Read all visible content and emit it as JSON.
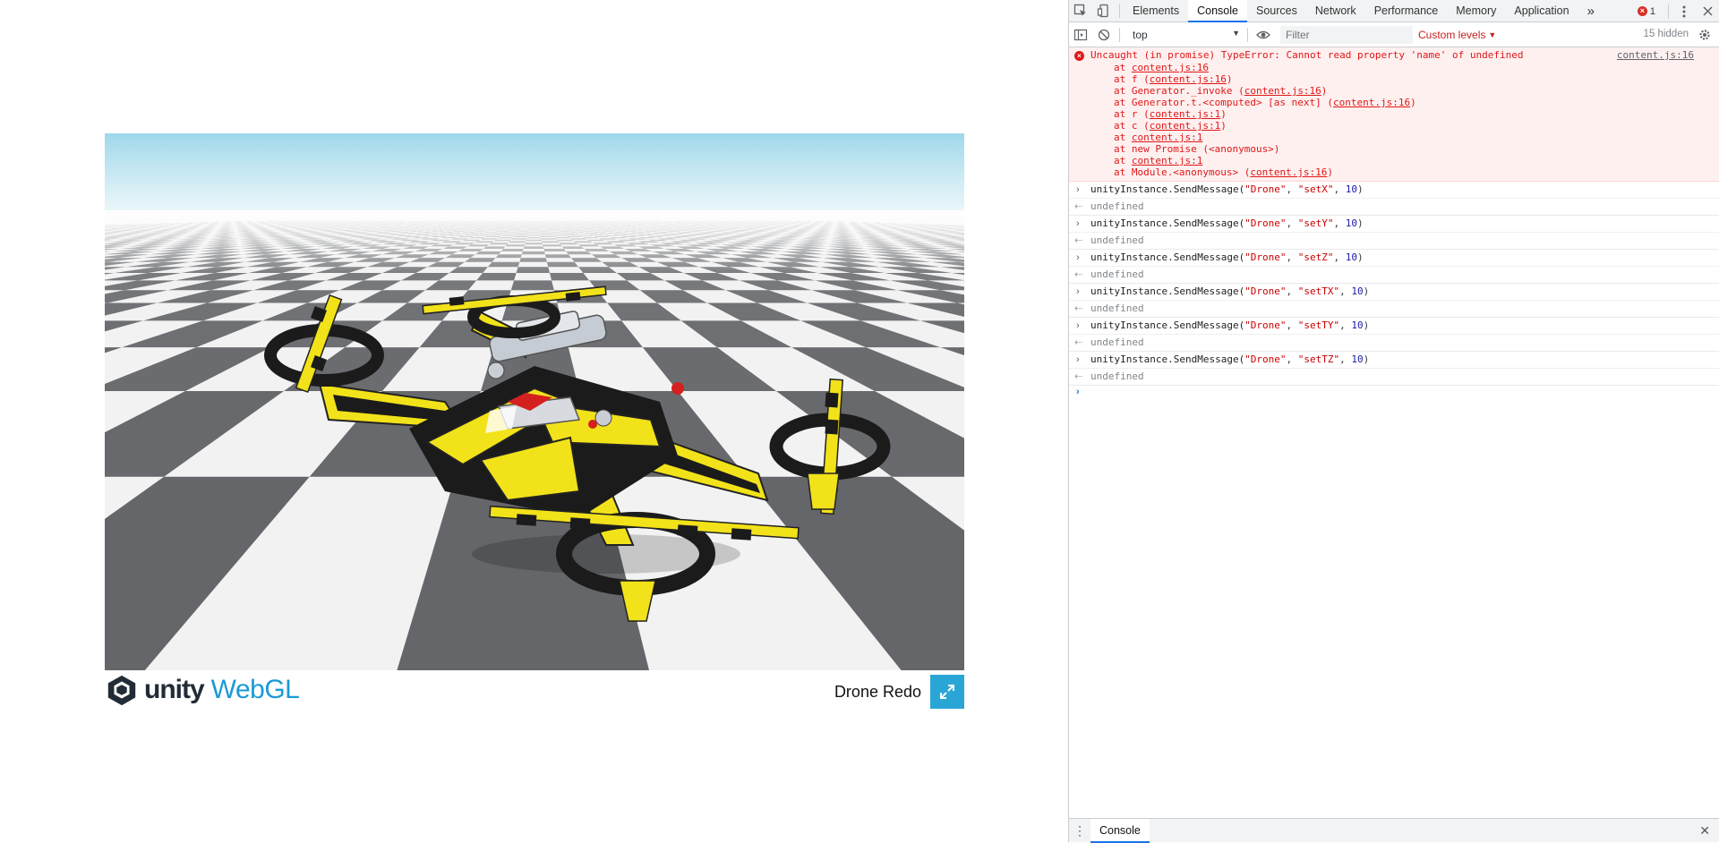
{
  "build": {
    "engine_word": "unity",
    "platform_word": "WebGL",
    "title": "Drone Redo"
  },
  "devtools": {
    "tabs": [
      "Elements",
      "Console",
      "Sources",
      "Network",
      "Performance",
      "Memory",
      "Application"
    ],
    "active_tab": "Console",
    "more_tabs": "»",
    "error_count": "1",
    "context": "top",
    "filter_placeholder": "Filter",
    "levels_label": "Custom levels",
    "hidden_label": "15 hidden",
    "drawer_tab": "Console"
  },
  "console": {
    "error": {
      "message": "Uncaught (in promise) TypeError: Cannot read property 'name' of undefined",
      "source": "content.js:16",
      "stack": [
        {
          "prefix": "at ",
          "link": "content.js:16",
          "suffix": ""
        },
        {
          "prefix": "at f (",
          "link": "content.js:16",
          "suffix": ")"
        },
        {
          "prefix": "at Generator._invoke (",
          "link": "content.js:16",
          "suffix": ")"
        },
        {
          "prefix": "at Generator.t.<computed> [as next] (",
          "link": "content.js:16",
          "suffix": ")"
        },
        {
          "prefix": "at r (",
          "link": "content.js:1",
          "suffix": ")"
        },
        {
          "prefix": "at c (",
          "link": "content.js:1",
          "suffix": ")"
        },
        {
          "prefix": "at ",
          "link": "content.js:1",
          "suffix": ""
        },
        {
          "prefix": "at new Promise (<anonymous>)",
          "link": "",
          "suffix": ""
        },
        {
          "prefix": "at ",
          "link": "content.js:1",
          "suffix": ""
        },
        {
          "prefix": "at Module.<anonymous> (",
          "link": "content.js:16",
          "suffix": ")"
        }
      ]
    },
    "commands": [
      {
        "fn": "unityInstance.SendMessage(",
        "obj": "\"Drone\"",
        "method": "\"setX\"",
        "num": "10",
        "result": "undefined"
      },
      {
        "fn": "unityInstance.SendMessage(",
        "obj": "\"Drone\"",
        "method": "\"setY\"",
        "num": "10",
        "result": "undefined"
      },
      {
        "fn": "unityInstance.SendMessage(",
        "obj": "\"Drone\"",
        "method": "\"setZ\"",
        "num": "10",
        "result": "undefined"
      },
      {
        "fn": "unityInstance.SendMessage(",
        "obj": "\"Drone\"",
        "method": "\"setTX\"",
        "num": "10",
        "result": "undefined"
      },
      {
        "fn": "unityInstance.SendMessage(",
        "obj": "\"Drone\"",
        "method": "\"setTY\"",
        "num": "10",
        "result": "undefined"
      },
      {
        "fn": "unityInstance.SendMessage(",
        "obj": "\"Drone\"",
        "method": "\"setTZ\"",
        "num": "10",
        "result": "undefined"
      }
    ]
  },
  "colors": {
    "accent": "#1a73e8",
    "error": "#e01818",
    "unity_blue": "#1b9ad6",
    "fullscreen_bg": "#2aa6d6",
    "drone_yellow": "#f2e21a",
    "drone_black": "#1b1b1b"
  },
  "icons": {
    "inspect": "cursor-select-icon",
    "device": "device-toggle-icon",
    "sidebar": "sidebar-toggle-icon",
    "clear": "clear-console-icon",
    "eye": "live-expression-eye-icon",
    "settings": "gear-icon",
    "fullscreen": "fullscreen-expand-icon"
  }
}
